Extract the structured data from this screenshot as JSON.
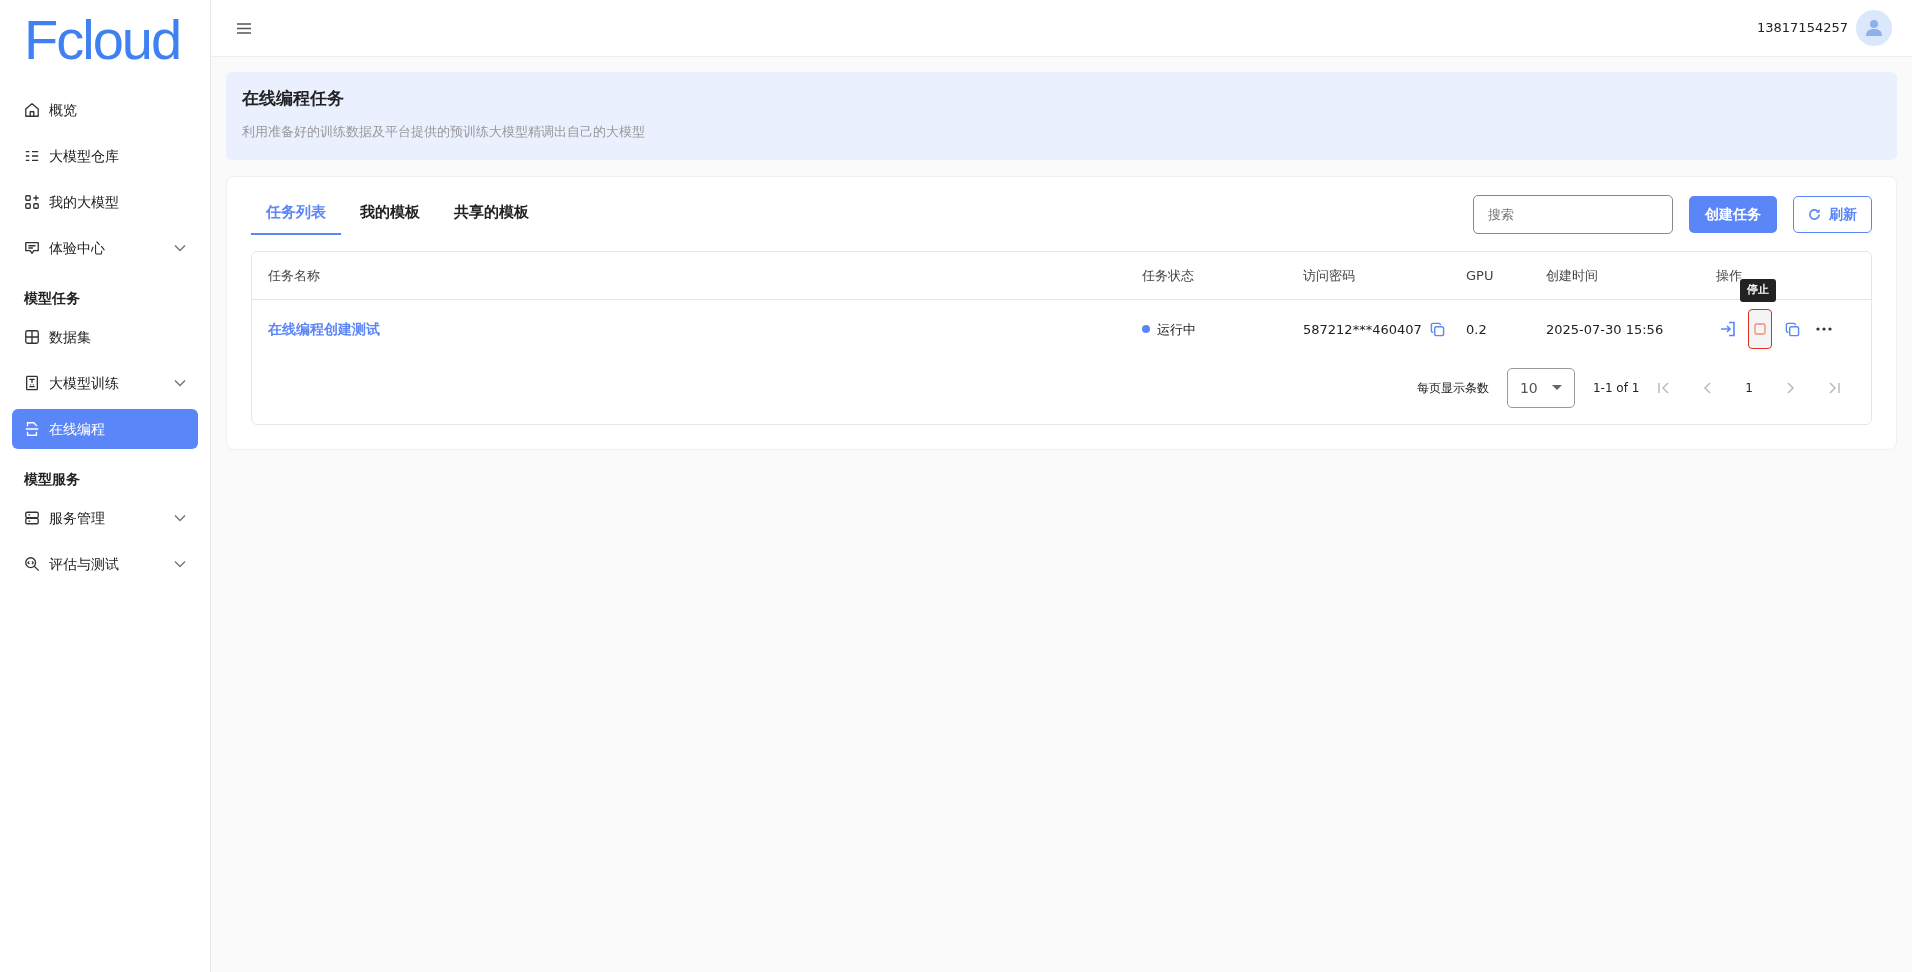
{
  "logo": "Fcloud",
  "sidebar": {
    "items": [
      {
        "kind": "item",
        "label": "概览",
        "selected": false,
        "expandable": false
      },
      {
        "kind": "item",
        "label": "大模型仓库",
        "selected": false,
        "expandable": false
      },
      {
        "kind": "item",
        "label": "我的大模型",
        "selected": false,
        "expandable": false
      },
      {
        "kind": "item",
        "label": "体验中心",
        "selected": false,
        "expandable": true
      },
      {
        "kind": "section",
        "label": "模型任务"
      },
      {
        "kind": "item",
        "label": "数据集",
        "selected": false,
        "expandable": false
      },
      {
        "kind": "item",
        "label": "大模型训练",
        "selected": false,
        "expandable": true
      },
      {
        "kind": "item",
        "label": "在线编程",
        "selected": true,
        "expandable": false
      },
      {
        "kind": "section",
        "label": "模型服务"
      },
      {
        "kind": "item",
        "label": "服务管理",
        "selected": false,
        "expandable": true
      },
      {
        "kind": "item",
        "label": "评估与测试",
        "selected": false,
        "expandable": true
      }
    ]
  },
  "header": {
    "user": "13817154257"
  },
  "banner": {
    "title": "在线编程任务",
    "subtitle": "利用准备好的训练数据及平台提供的预训练大模型精调出自己的大模型"
  },
  "tabs": [
    {
      "label": "任务列表",
      "selected": true
    },
    {
      "label": "我的模板",
      "selected": false
    },
    {
      "label": "共享的模板",
      "selected": false
    }
  ],
  "search": {
    "placeholder": "搜索"
  },
  "buttons": {
    "create": "创建任务",
    "refresh": "刷新"
  },
  "table": {
    "columns": [
      "任务名称",
      "任务状态",
      "访问密码",
      "GPU",
      "创建时间",
      "操作"
    ],
    "rows": [
      {
        "name": "在线编程创建测试",
        "status": "运行中",
        "password": "587212***460407",
        "gpu": "0.2",
        "created": "2025-07-30 15:56"
      }
    ]
  },
  "tooltip": "停止",
  "pagination": {
    "per_page_label": "每页显示条数",
    "per_page": "10",
    "range": "1-1 of 1",
    "page": "1"
  }
}
